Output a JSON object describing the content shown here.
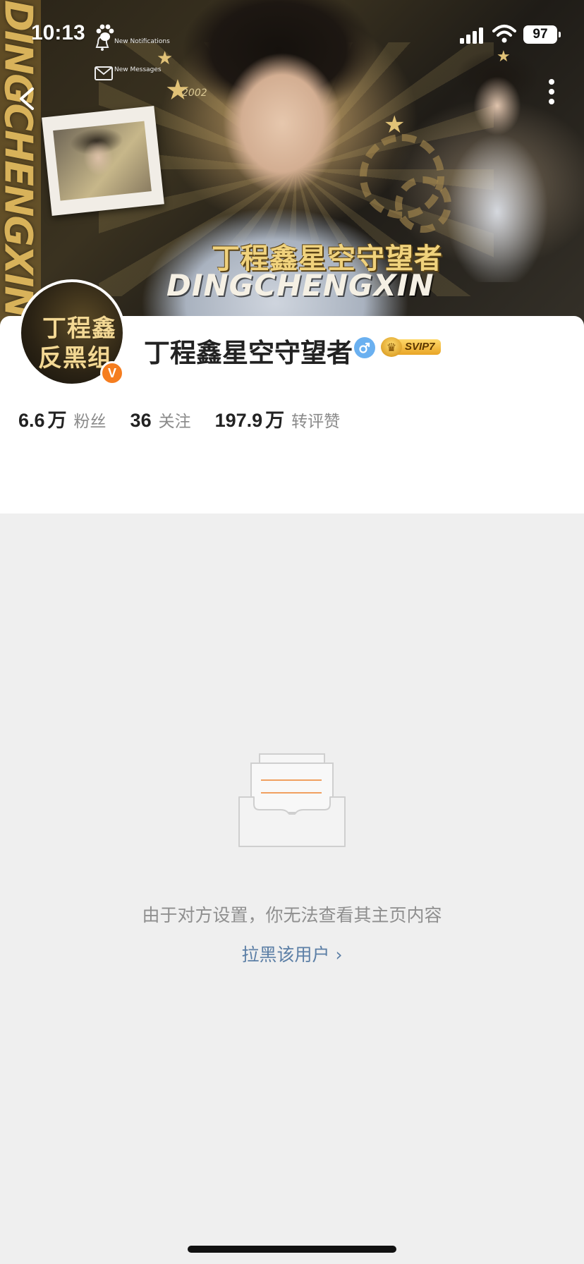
{
  "status_bar": {
    "time": "10:13",
    "battery": "97",
    "notifications_label": "New Notifications",
    "messages_label": "New Messages"
  },
  "banner": {
    "side_text": "DINGCHENGXIN",
    "title": "丁程鑫星空守望者",
    "subtitle": "DINGCHENGXIN",
    "year": "2002"
  },
  "profile": {
    "avatar_line1": "丁程鑫",
    "avatar_line2": "反黑组",
    "verified_mark": "V",
    "username": "丁程鑫星空守望者",
    "gender": "male",
    "vip_label": "SVIP7",
    "stats": [
      {
        "value": "6.6",
        "unit": "万",
        "label": "粉丝"
      },
      {
        "value": "36",
        "unit": "",
        "label": "关注"
      },
      {
        "value": "197.9",
        "unit": "万",
        "label": "转评赞"
      }
    ]
  },
  "empty_state": {
    "message": "由于对方设置，你无法查看其主页内容",
    "action": "拉黑该用户",
    "action_chevron": "›"
  },
  "colors": {
    "accent_orange": "#f57d1f",
    "link_blue": "#5c7fa6",
    "background": "#efefef"
  }
}
